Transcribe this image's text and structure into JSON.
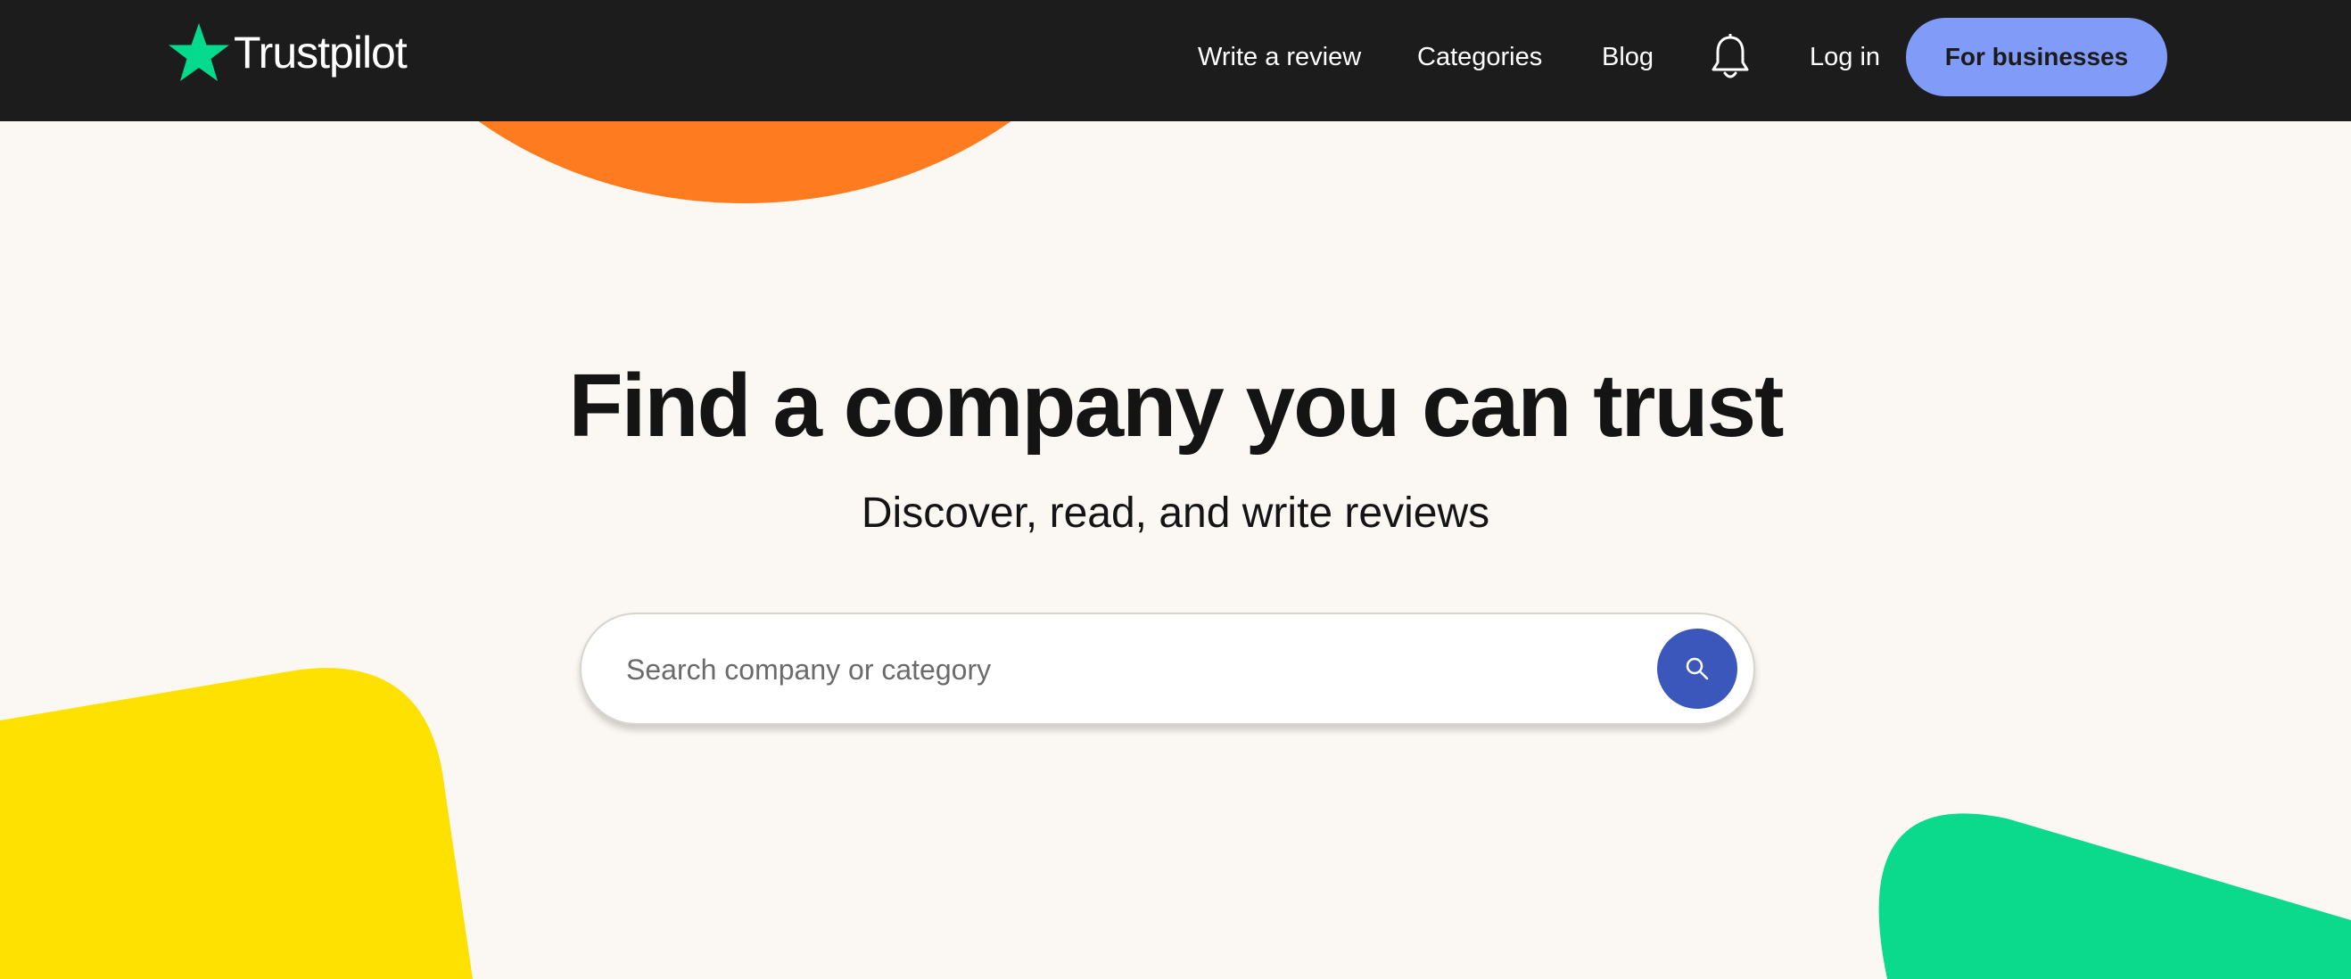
{
  "brand": {
    "name": "Trustpilot",
    "star_color": "#04da8d"
  },
  "nav": {
    "write_review": "Write a review",
    "categories": "Categories",
    "blog": "Blog",
    "notifications_icon": "bell-icon",
    "login": "Log in",
    "for_businesses": "For businesses"
  },
  "hero": {
    "title": "Find a company you can trust",
    "subtitle": "Discover, read, and write reviews"
  },
  "search": {
    "value": "",
    "placeholder": "Search company or category",
    "button_icon": "search-icon"
  },
  "colors": {
    "header_bg": "#1c1c1c",
    "page_bg": "#fbf8f3",
    "business_button": "#819bf8",
    "search_button": "#3c57bc",
    "orange_shape": "#ff7b1f",
    "yellow_shape": "#ffe100",
    "green_shape": "#0bd98c"
  }
}
